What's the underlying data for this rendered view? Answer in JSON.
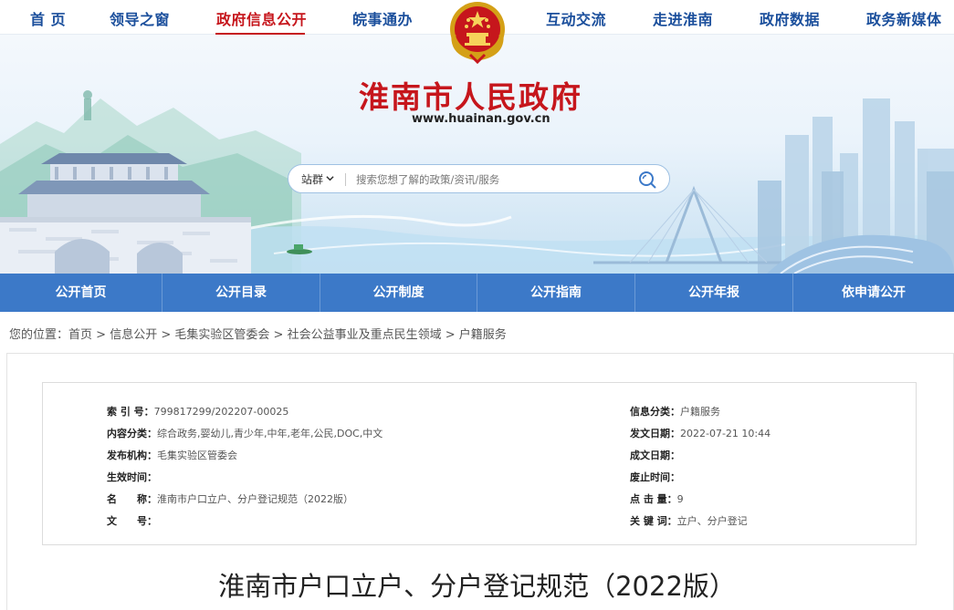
{
  "topnav": {
    "items": [
      "首 页",
      "领导之窗",
      "政府信息公开",
      "皖事通办",
      "互动交流",
      "走进淮南",
      "政府数据",
      "政务新媒体"
    ],
    "active_index": 2
  },
  "site": {
    "title": "淮南市人民政府",
    "url": "www.huainan.gov.cn"
  },
  "search": {
    "scope": "站群",
    "placeholder": "搜索您想了解的政策/资讯/服务"
  },
  "bluenav": {
    "items": [
      "公开首页",
      "公开目录",
      "公开制度",
      "公开指南",
      "公开年报",
      "依申请公开"
    ]
  },
  "breadcrumb": {
    "prefix": "您的位置：",
    "items": [
      "首页",
      "信息公开",
      "毛集实验区管委会",
      "社会公益事业及重点民生领域",
      "户籍服务"
    ],
    "separator": " > "
  },
  "meta": {
    "left": [
      {
        "label": "索 引 号：",
        "value": "799817299/202207-00025"
      },
      {
        "label": "内容分类：",
        "value": "综合政务,婴幼儿,青少年,中年,老年,公民,DOC,中文"
      },
      {
        "label": "发布机构：",
        "value": "毛集实验区管委会"
      },
      {
        "label": "生效时间：",
        "value": ""
      },
      {
        "label": "名　　称：",
        "value": "淮南市户口立户、分户登记规范（2022版）"
      },
      {
        "label": "文　　号：",
        "value": ""
      }
    ],
    "right": [
      {
        "label": "信息分类：",
        "value": "户籍服务"
      },
      {
        "label": "发文日期：",
        "value": "2022-07-21 10:44"
      },
      {
        "label": "成文日期：",
        "value": ""
      },
      {
        "label": "废止时间：",
        "value": ""
      },
      {
        "label": "点 击 量：",
        "value": "9"
      },
      {
        "label": "关 键 词：",
        "value": "立户、分户登记"
      }
    ]
  },
  "document": {
    "title": "淮南市户口立户、分户登记规范（2022版）"
  },
  "colors": {
    "brand_red": "#c6161c",
    "nav_blue": "#1b4f9c",
    "bar_blue": "#3c79c8"
  }
}
